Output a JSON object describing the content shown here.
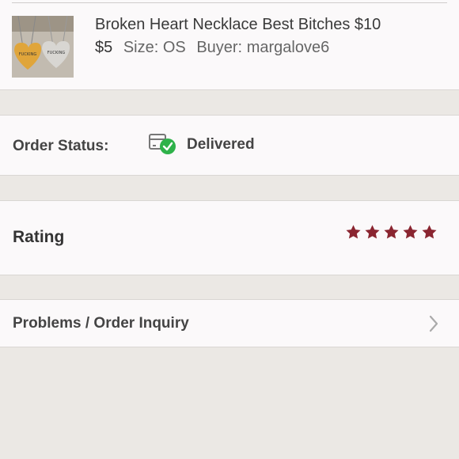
{
  "item": {
    "title": "Broken Heart Necklace Best Bitches $10",
    "price": "$5",
    "size_label": "Size:",
    "size_value": "OS",
    "buyer_label": "Buyer:",
    "buyer_value": "margalove6",
    "thumbnail_icon": "necklace-photo"
  },
  "order_status": {
    "label": "Order Status:",
    "value": "Delivered",
    "icon": "box-delivered-icon",
    "check_color": "#2eb24a"
  },
  "rating": {
    "label": "Rating",
    "stars": 5,
    "max_stars": 5,
    "star_color": "#8a2530"
  },
  "problems": {
    "label": "Problems / Order Inquiry",
    "icon": "chevron-right-icon"
  }
}
